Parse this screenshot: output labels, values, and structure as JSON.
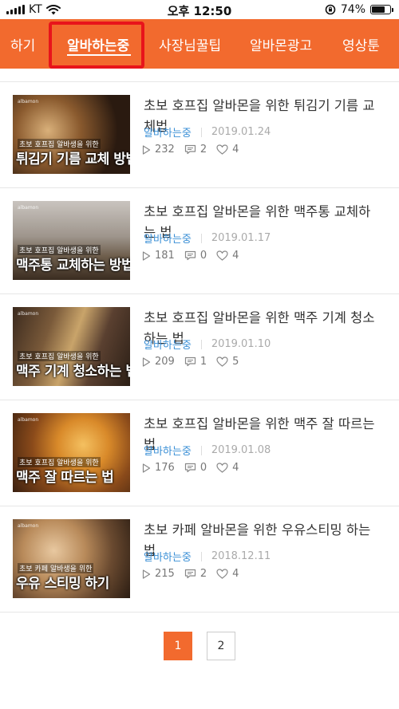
{
  "status_bar": {
    "carrier": "KT",
    "time": "오후 12:50",
    "battery_percent": "74%",
    "battery_level": 0.74,
    "icons": [
      "signal-icon",
      "wifi-icon",
      "rotation-lock-icon",
      "battery-icon"
    ]
  },
  "tabs": [
    {
      "label": "하기",
      "active": false
    },
    {
      "label": "알바하는중",
      "active": true
    },
    {
      "label": "사장님꿀팁",
      "active": false
    },
    {
      "label": "알바몬광고",
      "active": false
    },
    {
      "label": "영상툰",
      "active": false
    }
  ],
  "colors": {
    "brand": "#f26a2e",
    "highlight": "#e8141b",
    "category": "#3a8fd6"
  },
  "articles": [
    {
      "title": "초보 호프집 알바몬을 위한 튀김기 기름 교체법",
      "category": "알바하는중",
      "date": "2019.01.24",
      "views": "232",
      "comments": "2",
      "likes": "4",
      "thumb": {
        "brand": "albamon",
        "subtitle": "초보 호프집 알바생을 위한",
        "title": "튀김기 기름 교체 방법"
      }
    },
    {
      "title": "초보 호프집 알바몬을 위한 맥주통 교체하는 법",
      "category": "알바하는중",
      "date": "2019.01.17",
      "views": "181",
      "comments": "0",
      "likes": "4",
      "thumb": {
        "brand": "albamon",
        "subtitle": "초보 호프집 알바생을 위한",
        "title": "맥주통 교체하는 방법"
      }
    },
    {
      "title": "초보 호프집 알바몬을 위한 맥주 기계 청소하는 법",
      "category": "알바하는중",
      "date": "2019.01.10",
      "views": "209",
      "comments": "1",
      "likes": "5",
      "thumb": {
        "brand": "albamon",
        "subtitle": "초보 호프집 알바생을 위한",
        "title": "맥주 기계 청소하는 법"
      }
    },
    {
      "title": "초보 호프집 알바몬을 위한 맥주 잘 따르는 법",
      "category": "알바하는중",
      "date": "2019.01.08",
      "views": "176",
      "comments": "0",
      "likes": "4",
      "thumb": {
        "brand": "albamon",
        "subtitle": "초보 호프집 알바생을 위한",
        "title": "맥주 잘 따르는 법"
      }
    },
    {
      "title": "초보 카페 알바몬을 위한 우유스티밍 하는 법",
      "category": "알바하는중",
      "date": "2018.12.11",
      "views": "215",
      "comments": "2",
      "likes": "4",
      "thumb": {
        "brand": "albamon",
        "subtitle": "초보 카페 알바생을 위한",
        "title": "우유 스티밍 하기"
      }
    }
  ],
  "pagination": {
    "pages": [
      "1",
      "2"
    ],
    "current": "1"
  }
}
